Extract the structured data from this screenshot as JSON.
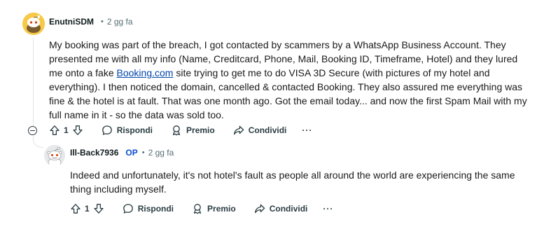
{
  "comments": [
    {
      "author": "EnutniSDM",
      "time": "2 gg fa",
      "body_before": "My booking was part of the breach, I got contacted by scammers by a WhatsApp Business Account. They presented me with all my info (Name, Creditcard, Phone, Mail, Booking ID, Timeframe, Hotel) and they lured me onto a fake ",
      "link": "Booking.com",
      "body_after": " site trying to get me to do VISA 3D Secure (with pictures of my hotel and everything). I then noticed the domain, cancelled & contacted Booking. They also assured me everything was fine & the hotel is at fault. That was one month ago. Got the email today... and now the first Spam Mail with my full name in it - so the data was sold too.",
      "votes": "1",
      "reply": "Rispondi",
      "award": "Premio",
      "share": "Condividi",
      "more": "···"
    },
    {
      "author": "Ill-Back7936",
      "op_badge": "OP",
      "time": "2 gg fa",
      "body": "Indeed and unfortunately, it's not hotel's fault as people all around the world are experiencing the same thing including myself.",
      "votes": "1",
      "reply": "Rispondi",
      "award": "Premio",
      "share": "Condividi",
      "more": "···"
    }
  ],
  "icons": {
    "avatar_1": "snoo-avatar-yellow",
    "avatar_2": "snoo-avatar-grey",
    "upvote": "arrow-up-icon",
    "downvote": "arrow-down-icon",
    "reply": "speech-bubble-icon",
    "award": "award-ribbon-icon",
    "share": "share-arrow-icon",
    "collapse": "minus-circle-icon"
  },
  "colors": {
    "op_badge": "#0a4ecc",
    "link": "#0045ac",
    "meta": "#576f76",
    "avatar_1_bg": "#f7c948"
  }
}
